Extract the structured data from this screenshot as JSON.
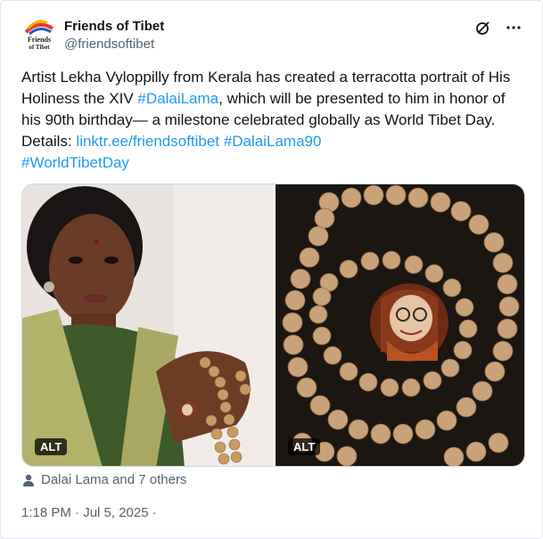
{
  "author": {
    "name": "Friends of Tibet",
    "handle": "@friendsoftibet",
    "logo_text": "Friends of Tibet"
  },
  "post": {
    "text_before_1": "Artist Lekha Vyloppilly from Kerala has created a terracotta portrait of His Holiness the XIV ",
    "hashtag_1": "#DalaiLama",
    "text_before_2": ", which will be presented to him in honor of his 90th birthday— a milestone celebrated globally as World Tibet Day. Details: ",
    "link": "linktr.ee/friendsoftibet",
    "space": " ",
    "hashtag_2": "#DalaiLama90",
    "hashtag_3": "#WorldTibetDay"
  },
  "media": {
    "alt_label": "ALT"
  },
  "tagged": "Dalai Lama and 7 others",
  "timestamp": "1:18 PM · Jul 5, 2025 ·",
  "icons": {
    "logo": "friends-of-tibet-logo",
    "grok": "grok-icon",
    "more": "more-icon",
    "person": "person-icon"
  },
  "colors": {
    "link": "#1d9bf0",
    "muted": "#536471",
    "text": "#0f1419"
  }
}
